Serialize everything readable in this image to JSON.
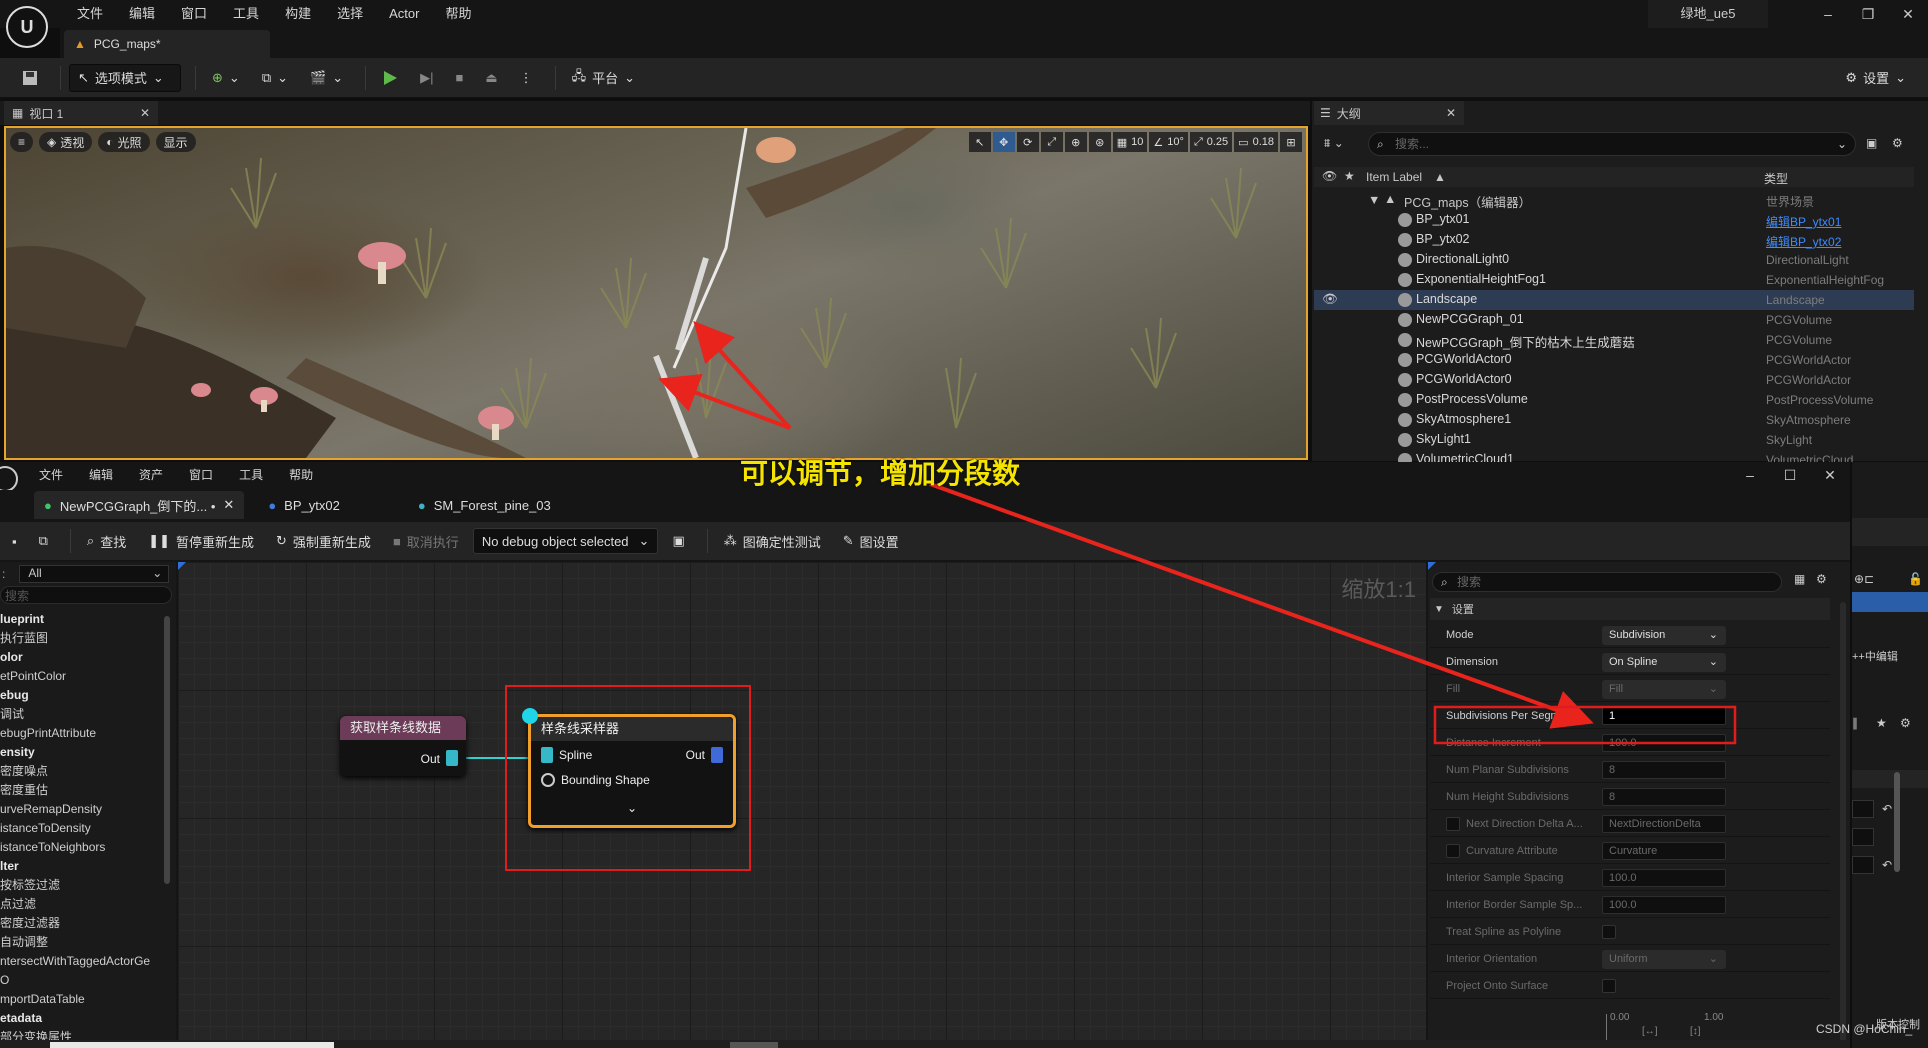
{
  "menubar": {
    "items": [
      "文件",
      "编辑",
      "窗口",
      "工具",
      "构建",
      "选择",
      "Actor",
      "帮助"
    ],
    "project": "绿地_ue5"
  },
  "map_tab": {
    "label": "PCG_maps*"
  },
  "toolbar": {
    "mode": "选项模式",
    "platform": "平台",
    "settings": "设置"
  },
  "viewport": {
    "tab": "视口 1",
    "perspective": "透视",
    "lighting": "光照",
    "show": "显示",
    "grid_snap": "10",
    "rot_snap": "10°",
    "scale_snap": "0.25",
    "cam_speed": "0.18"
  },
  "outliner": {
    "tab": "大纲",
    "search_placeholder": "搜索...",
    "col_label": "Item Label",
    "col_type": "类型",
    "root": {
      "label": "PCG_maps（编辑器）",
      "type": "世界场景"
    },
    "rows": [
      {
        "label": "BP_ytx01",
        "type": "编辑BP_ytx01",
        "link": true
      },
      {
        "label": "BP_ytx02",
        "type": "编辑BP_ytx02",
        "link": true
      },
      {
        "label": "DirectionalLight0",
        "type": "DirectionalLight"
      },
      {
        "label": "ExponentialHeightFog1",
        "type": "ExponentialHeightFog"
      },
      {
        "label": "Landscape",
        "type": "Landscape",
        "selected": true
      },
      {
        "label": "NewPCGGraph_01",
        "type": "PCGVolume"
      },
      {
        "label": "NewPCGGraph_倒下的枯木上生成蘑菇",
        "type": "PCGVolume"
      },
      {
        "label": "PCGWorldActor0",
        "type": "PCGWorldActor"
      },
      {
        "label": "PCGWorldActor0",
        "type": "PCGWorldActor"
      },
      {
        "label": "PostProcessVolume",
        "type": "PostProcessVolume"
      },
      {
        "label": "SkyAtmosphere1",
        "type": "SkyAtmosphere"
      },
      {
        "label": "SkyLight1",
        "type": "SkyLight"
      },
      {
        "label": "VolumetricCloud1",
        "type": "VolumetricCloud"
      }
    ]
  },
  "pcg": {
    "menu": [
      "文件",
      "编辑",
      "资产",
      "窗口",
      "工具",
      "帮助"
    ],
    "tabs": [
      "NewPCGGraph_倒下的... •",
      "BP_ytx02",
      "SM_Forest_pine_03"
    ],
    "toolbar": {
      "find": "查找",
      "pause": "暂停重新生成",
      "force": "强制重新生成",
      "cancel": "取消执行",
      "debug": "No debug object selected",
      "determinism": "图确定性测试",
      "graph_settings": "图设置"
    },
    "palette": {
      "filter": "All",
      "search_placeholder": "搜索",
      "items": [
        {
          "t": "lueprint",
          "cat": true
        },
        {
          "t": "执行蓝图"
        },
        {
          "t": "olor",
          "cat": true
        },
        {
          "t": "etPointColor"
        },
        {
          "t": "ebug",
          "cat": true
        },
        {
          "t": "调试"
        },
        {
          "t": "ebugPrintAttribute"
        },
        {
          "t": "ensity",
          "cat": true
        },
        {
          "t": "密度噪点"
        },
        {
          "t": "密度重估"
        },
        {
          "t": "urveRemapDensity"
        },
        {
          "t": "istanceToDensity"
        },
        {
          "t": "istanceToNeighbors"
        },
        {
          "t": "lter",
          "cat": true
        },
        {
          "t": "按标签过滤"
        },
        {
          "t": "点过滤"
        },
        {
          "t": "密度过滤器"
        },
        {
          "t": "自动调整"
        },
        {
          "t": "ntersectWithTaggedActorGe"
        },
        {
          "t": "O"
        },
        {
          "t": "mportDataTable"
        },
        {
          "t": "etadata",
          "cat": true
        },
        {
          "t": "部分变换属性"
        }
      ]
    },
    "zoom": "缩放1:1",
    "nodes": {
      "get_spline": {
        "title": "获取样条线数据",
        "out": "Out"
      },
      "sampler": {
        "title": "样条线采样器",
        "in1": "Spline",
        "in2": "Bounding Shape",
        "out": "Out"
      }
    },
    "details": {
      "search_placeholder": "搜索",
      "section": "设置",
      "rows": [
        {
          "label": "Mode",
          "kind": "combo",
          "value": "Subdivision"
        },
        {
          "label": "Dimension",
          "kind": "combo",
          "value": "On Spline"
        },
        {
          "label": "Fill",
          "kind": "combo",
          "value": "Fill",
          "dim": true
        },
        {
          "label": "Subdivisions Per Segment",
          "kind": "value",
          "value": "1",
          "highlight": true
        },
        {
          "label": "Distance Increment",
          "kind": "value",
          "value": "100.0",
          "dim": true
        },
        {
          "label": "Num Planar Subdivisions",
          "kind": "value",
          "value": "8",
          "dim": true
        },
        {
          "label": "Num Height Subdivisions",
          "kind": "value",
          "value": "8",
          "dim": true
        },
        {
          "label": "Next Direction Delta A...",
          "kind": "value",
          "value": "NextDirectionDelta",
          "dim": true,
          "check": true
        },
        {
          "label": "Curvature Attribute",
          "kind": "value",
          "value": "Curvature",
          "dim": true,
          "check": true
        },
        {
          "label": "Interior Sample Spacing",
          "kind": "value",
          "value": "100.0",
          "dim": true
        },
        {
          "label": "Interior Border Sample Sp...",
          "kind": "value",
          "value": "100.0",
          "dim": true
        },
        {
          "label": "Treat Spline as Polyline",
          "kind": "check",
          "dim": true
        },
        {
          "label": "Interior Orientation",
          "kind": "combo",
          "value": "Uniform",
          "dim": true
        },
        {
          "label": "Project Onto Surface",
          "kind": "check",
          "dim": true
        }
      ],
      "curve_min": "0.00",
      "curve_max": "1.00"
    },
    "right_strip": {
      "edit": "++中编辑",
      "source": "版本控制"
    }
  },
  "annotation": {
    "text": "可以调节，增加分段数",
    "color": "#f5e400",
    "arrow_color": "#e8241c"
  },
  "watermark": "CSDN @HoChin_"
}
